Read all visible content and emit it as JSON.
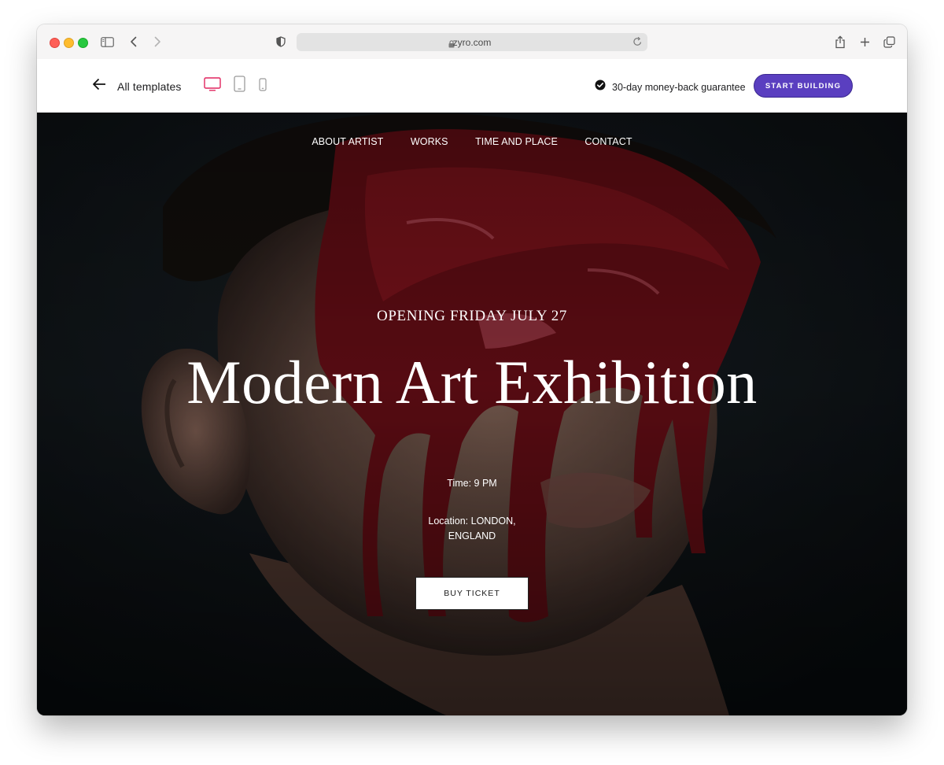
{
  "browser": {
    "url": "zyro.com"
  },
  "toolbar": {
    "back_label": "All templates",
    "guarantee_text": "30-day money-back guarantee",
    "start_label": "START BUILDING",
    "active_device_color": "#e0245e",
    "brand_color": "#5a3fc0"
  },
  "hero": {
    "nav": [
      "ABOUT ARTIST",
      "WORKS",
      "TIME AND PLACE",
      "CONTACT"
    ],
    "opening": "OPENING FRIDAY JULY 27",
    "title": "Modern Art Exhibition",
    "time": "Time: 9 PM",
    "location_line1": "Location: LONDON,",
    "location_line2": "ENGLAND",
    "button_label": "BUY TICKET"
  }
}
